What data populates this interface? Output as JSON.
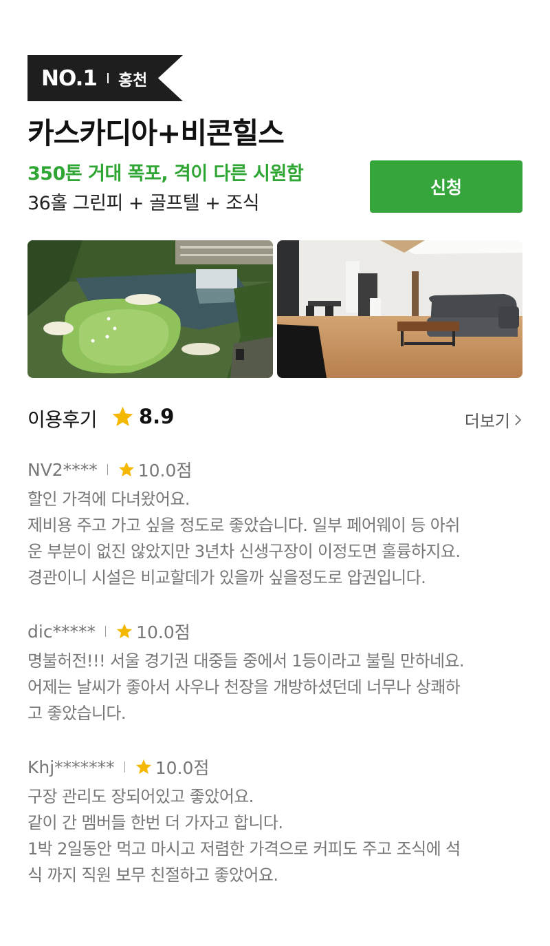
{
  "badge": {
    "rank": "NO.1",
    "region": "홍천"
  },
  "course": {
    "title": "카스카디아+비콘힐스",
    "highlight": "350톤 거대 폭포, 격이 다른 시원함",
    "package": "36홀 그린피 + 골프텔 + 조식"
  },
  "apply_button": {
    "label": "신청"
  },
  "photos": [
    {
      "subject": "golf course green with waterfall"
    },
    {
      "subject": "golftel living room with sofa"
    }
  ],
  "reviews_section": {
    "title": "이용후기",
    "rating": "8.9",
    "more_label": "더보기"
  },
  "reviews": [
    {
      "user": "NV2****",
      "score": "10.0점",
      "lines": [
        "할인 가격에 다녀왔어요.",
        "제비용 주고 가고 싶을 정도로 좋았습니다. 일부 페어웨이 등 아쉬",
        "운 부분이 없진 않았지만 3년차 신생구장이 이정도면 훌륭하지요.",
        "경관이니 시설은 비교할데가 있을까 싶을정도로 압권입니다."
      ]
    },
    {
      "user": "dic*****",
      "score": "10.0점",
      "lines": [
        "명불허전!!! 서울 경기권 대중들 중에서 1등이라고 불릴 만하네요.",
        "어제는 날씨가 좋아서 사우나 천장을 개방하셨던데 너무나 상쾌하",
        "고 좋았습니다."
      ]
    },
    {
      "user": "Khj*******",
      "score": "10.0점",
      "lines": [
        "구장 관리도 장되어있고 좋았어요.",
        "같이 간 멤버들 한번 더 가자고 합니다.",
        "1박 2일동안 먹고 마시고 저렴한 가격으로 커피도 주고 조식에 석",
        "식 까지 직원 보무 친절하고 좋았어요."
      ]
    }
  ],
  "colors": {
    "accent_green": "#35a53c",
    "highlight_green": "#2fa634",
    "star": "#f5b800",
    "badge_bg": "#1e1e1e"
  },
  "icons": {
    "star": "star-icon",
    "more": "chevron-right-icon"
  }
}
